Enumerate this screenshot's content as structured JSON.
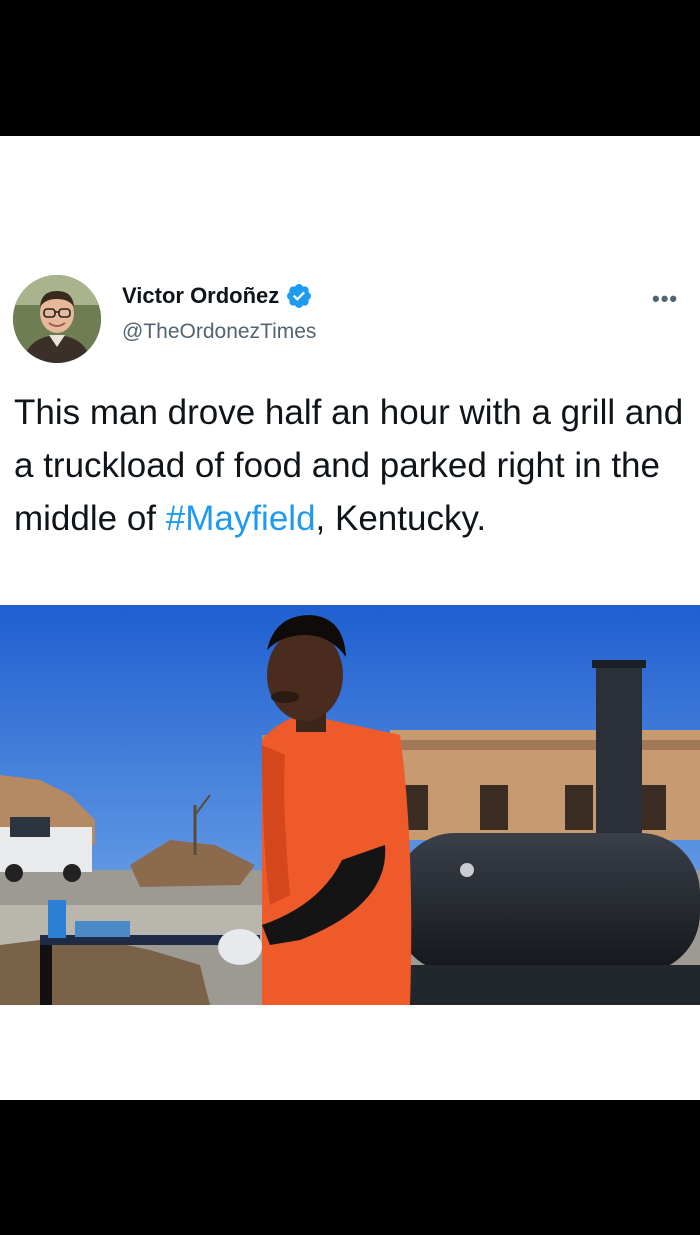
{
  "tweet": {
    "author_name": "Victor Ordoñez",
    "author_handle": "@TheOrdonezTimes",
    "verified_icon": "verified-badge-icon",
    "more_label": "•••",
    "text_before": "This man drove half an hour with a grill and a truckload of food and parked right in the middle of ",
    "hashtag": "#Mayfield",
    "text_after": ", Kentucky.",
    "media_icon": "photo-man-grill-tornado-damage"
  },
  "colors": {
    "hashtag": "#1d9bf0",
    "verified": "#1d9bf0",
    "text": "#0f1419",
    "secondary": "#536471"
  }
}
